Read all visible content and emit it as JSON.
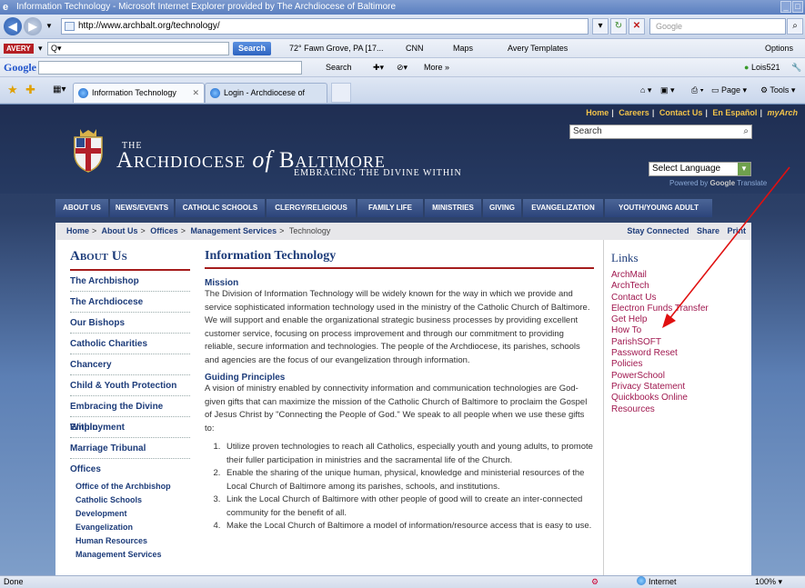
{
  "window": {
    "title": "Information Technology - Microsoft Internet Explorer provided by The Archdiocese of Baltimore"
  },
  "address": {
    "url": "http://www.archbalt.org/technology/",
    "search_placeholder": "Google"
  },
  "toolbar_avery": {
    "brand": "AVERY",
    "search_label": "Search",
    "weather": "72° Fawn Grove, PA [17...",
    "cnn": "CNN",
    "maps": "Maps",
    "templates": "Avery Templates",
    "options": "Options"
  },
  "toolbar_google": {
    "brand": "Google",
    "search_label": "Search",
    "more": "More »",
    "user": "Lois521"
  },
  "tabs": [
    {
      "label": "Information Technology"
    },
    {
      "label": "Login - Archdiocese of Baltim..."
    }
  ],
  "command_bar": {
    "page": "Page",
    "tools": "Tools"
  },
  "site": {
    "toplinks": [
      "Home",
      "Careers",
      "Contact Us",
      "En Español",
      "myArch"
    ],
    "search_placeholder": "Search",
    "language": "Select Language",
    "powered_by": "Powered by",
    "powered_brand": "Google",
    "powered_suffix": "Translate",
    "logo_the": "THE",
    "logo_pre": "Archdiocese",
    "logo_of": "of",
    "logo_post": "Baltimore",
    "tagline": "EMBRACING THE DIVINE WITHIN"
  },
  "nav": [
    "ABOUT US",
    "NEWS/EVENTS",
    "CATHOLIC SCHOOLS",
    "CLERGY/RELIGIOUS",
    "FAMILY LIFE",
    "MINISTRIES",
    "GIVING",
    "EVANGELIZATION",
    "YOUTH/YOUNG ADULT"
  ],
  "breadcrumb": {
    "items": [
      "Home",
      "About Us",
      "Offices",
      "Management Services"
    ],
    "current": "Technology",
    "sep": ">",
    "share": [
      "Stay Connected",
      "Share",
      "Print"
    ]
  },
  "sidebar": {
    "title": "About Us",
    "items": [
      "The Archbishop",
      "The Archdiocese",
      "Our Bishops",
      "Catholic Charities",
      "Chancery",
      "Child & Youth Protection",
      "Embracing the Divine Within",
      "Employment",
      "Marriage Tribunal",
      "Offices"
    ],
    "subitems": [
      "Office of the Archbishop",
      "Catholic Schools",
      "Development",
      "Evangelization",
      "Human Resources",
      "Management Services"
    ]
  },
  "main": {
    "title": "Information Technology",
    "mission_head": "Mission",
    "mission_text": "The Division of Information Technology will be widely known for the way in which we provide and service sophisticated information technology used in the ministry of the Catholic Church of Baltimore. We will support and enable the organizational strategic business processes by providing excellent customer service, focusing on process improvement and through our commitment to providing reliable, secure information and technologies. The people of the Archdiocese, its parishes, schools and agencies are the focus of our evangelization through information.",
    "principles_head": "Guiding Principles",
    "principles_text": "A vision of ministry enabled by connectivity information and communication technologies are God-given gifts that can maximize the mission of the Catholic Church of Baltimore to proclaim the Gospel of Jesus Christ by \"Connecting the People of God.\" We speak to all people when we use these gifts to:",
    "principles": [
      "Utilize proven technologies to reach all Catholics, especially youth and young adults, to promote their fuller participation in ministries and the sacramental life of the Church.",
      "Enable the sharing of the unique human, physical, knowledge and ministerial resources of the Local Church of Baltimore among its parishes, schools, and institutions.",
      "Link the Local Church of Baltimore with other people of good will to create an inter-connected community for the benefit of all.",
      "Make the Local Church of Baltimore a model of information/resource access that is easy to use."
    ]
  },
  "links": {
    "title": "Links",
    "items": [
      "ArchMail",
      "ArchTech",
      "Contact Us",
      "Electron Funds Transfer",
      "Get Help",
      "How To",
      "ParishSOFT",
      "Password Reset",
      "Policies",
      "PowerSchool",
      "Privacy Statement",
      "Quickbooks Online",
      "Resources"
    ]
  },
  "status": {
    "text": "Done",
    "zone": "Internet",
    "zoom": "100%"
  },
  "colors": {
    "accent": "#a51c1c",
    "link": "#a0184f",
    "navy": "#1d3c7a",
    "annotation": "#e01010"
  }
}
